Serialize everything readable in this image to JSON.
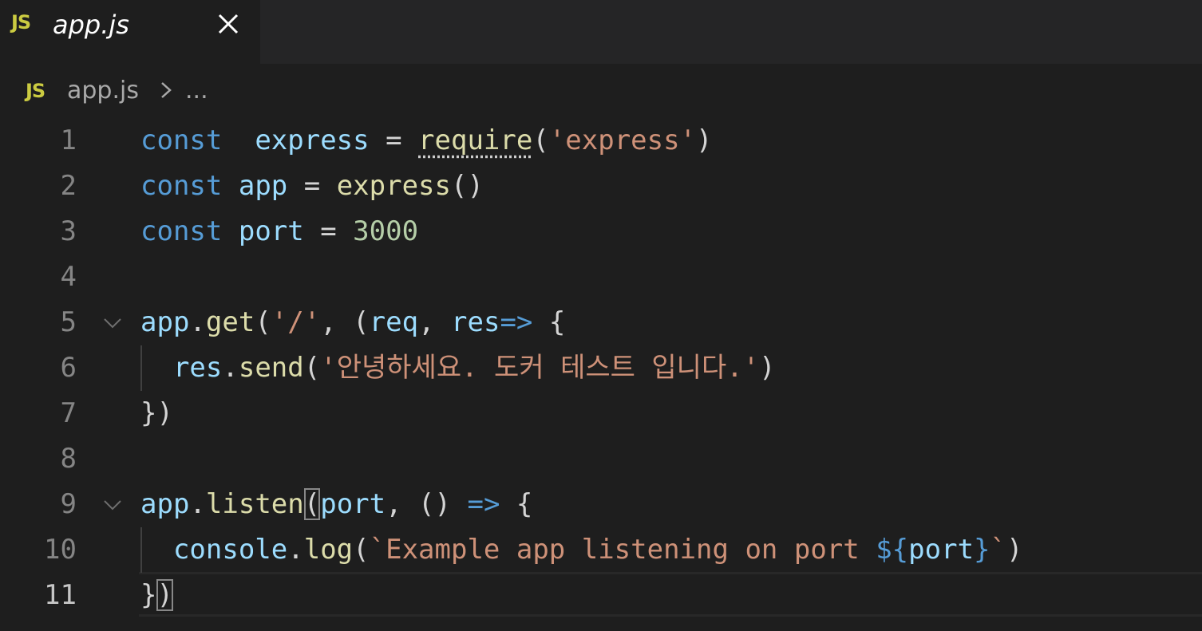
{
  "tab": {
    "badge": "JS",
    "title": "app.js"
  },
  "breadcrumb": {
    "badge": "JS",
    "file": "app.js",
    "separator": "›",
    "more": "..."
  },
  "lines": [
    {
      "n": "1",
      "tokens": [
        [
          "kw",
          "const"
        ],
        [
          "",
          "  "
        ],
        [
          "var",
          "express"
        ],
        [
          "",
          " = "
        ],
        [
          "fn",
          "require"
        ],
        [
          "",
          "("
        ],
        [
          "str",
          "'express'"
        ],
        [
          "",
          ")"
        ]
      ]
    },
    {
      "n": "2",
      "tokens": [
        [
          "kw",
          "const"
        ],
        [
          "",
          ""
        ],
        [
          "var",
          "app"
        ],
        [
          "",
          " = "
        ],
        [
          "fn",
          "express"
        ],
        [
          "",
          "()"
        ]
      ]
    },
    {
      "n": "3",
      "tokens": [
        [
          "kw",
          "const"
        ],
        [
          "",
          ""
        ],
        [
          "var",
          "port"
        ],
        [
          "",
          " = "
        ],
        [
          "num",
          "3000"
        ]
      ]
    },
    {
      "n": "4",
      "tokens": []
    },
    {
      "n": "5",
      "tokens": [
        [
          "var",
          "app"
        ],
        [
          "",
          "."
        ],
        [
          "fn",
          "get"
        ],
        [
          "",
          "("
        ],
        [
          "str",
          "'/'"
        ],
        [
          "",
          ", ("
        ],
        [
          "param",
          "req"
        ],
        [
          "",
          ", "
        ],
        [
          "param",
          "res"
        ],
        [
          ") "
        ],
        [
          "arrow",
          "=>"
        ],
        [
          "",
          " {"
        ]
      ]
    },
    {
      "n": "6",
      "tokens": [
        [
          "",
          "  "
        ],
        [
          "var",
          "res"
        ],
        [
          "",
          "."
        ],
        [
          "fn",
          "send"
        ],
        [
          "",
          "("
        ],
        [
          "str",
          "'안녕하세요. 도커 테스트 입니다.'"
        ],
        [
          "",
          ")"
        ]
      ]
    },
    {
      "n": "7",
      "tokens": [
        [
          "",
          "})"
        ]
      ]
    },
    {
      "n": "8",
      "tokens": []
    },
    {
      "n": "9",
      "tokens": [
        [
          "var",
          "app"
        ],
        [
          "",
          "."
        ],
        [
          "fn",
          "listen"
        ],
        [
          "",
          "("
        ],
        [
          "param",
          "port"
        ],
        [
          "",
          ", () "
        ],
        [
          "arrow",
          "=>"
        ],
        [
          "",
          " {"
        ]
      ]
    },
    {
      "n": "10",
      "tokens": [
        [
          "",
          "  "
        ],
        [
          "var",
          "console"
        ],
        [
          "",
          "."
        ],
        [
          "fn",
          "log"
        ],
        [
          "",
          "("
        ],
        [
          "str",
          "`Example app listening on port "
        ],
        [
          "kw",
          "${"
        ],
        [
          "var",
          "port"
        ],
        [
          "kw",
          "}"
        ],
        [
          "str",
          "`"
        ],
        [
          "",
          ")"
        ]
      ]
    },
    {
      "n": "11",
      "tokens": [
        [
          "",
          "})"
        ]
      ]
    }
  ],
  "colors": {
    "background": "#1e1e1e",
    "keyword": "#569cd6",
    "variable": "#9cdcfe",
    "function": "#dcdcaa",
    "string": "#ce9178",
    "number": "#b5cea8",
    "js_badge": "#cbcb41"
  },
  "icons": {
    "close": "close-icon",
    "fold": "chevron-down-icon",
    "breadcrumb_sep": "chevron-right-icon"
  }
}
